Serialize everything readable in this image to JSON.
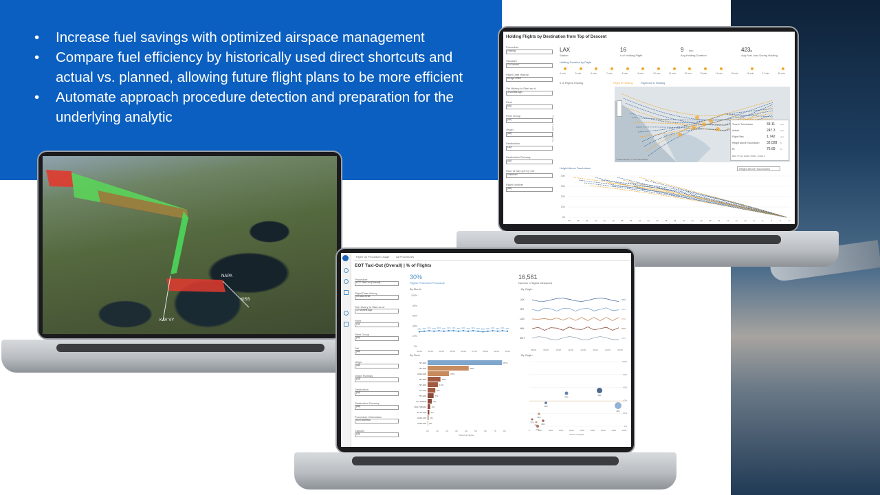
{
  "slide": {
    "bullets": [
      "Increase fuel savings with optimized airspace management",
      "Compare fuel efficiency by historically used direct shortcuts and actual vs. planned, allowing future flight plans to be more efficient",
      "Automate approach procedure detection and preparation for the underlying analytic"
    ],
    "colors": {
      "banner": "#0b5fc0",
      "text": "#ffffff"
    }
  },
  "holding_dashboard": {
    "title": "Holding Flights by Destination from Top of Descent",
    "filters": [
      "Procedure",
      "Visualize",
      "Flight Date History",
      "Set History to Start as of",
      "Fleet",
      "Fleet Group",
      "Origin",
      "Destination",
      "Destination Runway",
      "Hour of Day (UTC) | Dir",
      "Flight Number"
    ],
    "filter_values": [
      "Holding",
      "Go Around",
      "Entire Descent Phase",
      "21-Dec-2016",
      "01-Apr-2018",
      "3 Months Ago",
      "(All)",
      "(All)",
      "(All)",
      "LAX",
      "(All)",
      "Unknown",
      "(All)"
    ],
    "kpis": [
      {
        "value": "LAX",
        "label": "Station"
      },
      {
        "value": "16",
        "label": "# of Holding Flight"
      },
      {
        "value": "9",
        "unit": "min",
        "label": "Avg Holding Duration"
      },
      {
        "value": "423",
        "unit": "kg",
        "label": "Avg Fuel Loss During Holding"
      }
    ],
    "holding_duration_title": "Holding Duration by Flight",
    "duration_ticks": [
      "4 min",
      "5 min",
      "6 min",
      "7 min",
      "8 min",
      "9 min",
      "10 min",
      "11 min",
      "12 min",
      "13 min",
      "14 min",
      "15 min",
      "16 min",
      "17 min",
      "18 min"
    ],
    "flights_holding_label": "# of Flights Holding",
    "map_toggle": [
      "Flight in Holding",
      "Flight not in Holding"
    ],
    "tooltip": {
      "rows": [
        {
          "label": "Time to Touchdown",
          "value": "33.11",
          "unit": "min"
        },
        {
          "label": "Actual",
          "value": "247.3",
          "unit": "nmi"
        },
        {
          "label": "Flight Plan",
          "value": "1,742",
          "unit": "nmi"
        },
        {
          "label": "Height Above Touchdown",
          "value": "32,028",
          "unit": "ft"
        },
        {
          "label": "Rt",
          "value": "76.69",
          "unit": "%"
        }
      ],
      "footer": "DEN | TCH: 10420 / 0000 - 11442.9"
    },
    "map_attribution": "© 2022 Mapbox © OpenStreetMap",
    "height_chart_title": "Height Above Touchdown",
    "height_select": "Height Above Touchdown",
    "height_yticks": [
      "40K",
      "30K",
      "20K",
      "10K",
      "0K"
    ],
    "height_xticks": [
      "50",
      "48",
      "46",
      "44",
      "42",
      "40",
      "38",
      "36",
      "34",
      "32",
      "30",
      "28",
      "26",
      "24",
      "22",
      "20",
      "18",
      "16",
      "14",
      "12",
      "10",
      "8",
      "6",
      "4",
      "2",
      "0"
    ],
    "height_xlabel": "Time to Touchdown (min)",
    "y_axis_label": "Number of Flights (UTC day)",
    "colors": {
      "holding": "#f0a830",
      "not_holding": "#4a6e9a"
    }
  },
  "procedure_dashboard": {
    "tabs": [
      "Flight Op Procedure Usage",
      "All Procedures"
    ],
    "title": "EOT Taxi-Out (Overall) | % of Flights",
    "headline_pct": "30%",
    "headline_pct_label": "Flights Performed Procedure",
    "headline_count": "16,561",
    "headline_count_label": "Number of flights Measured",
    "filters": [
      "Procedure",
      "Flight Date History",
      "Set History to Start as of",
      "Fleet",
      "Fleet Group",
      "Tail",
      "Origin",
      "Origin Runway",
      "Destination",
      "Destination Runway",
      "Procedure Orientation",
      "Captain"
    ],
    "filter_values": [
      "EOT Taxi-Out (Overall)",
      "01-Mar-2018",
      "31-Apr-2018",
      "12 Months Ago",
      "(All)",
      "(All)",
      "(All)",
      "(All)",
      "(All)",
      "(All)",
      "(All)",
      "Not Essential",
      "(All)"
    ],
    "by_month": {
      "title": "By Month",
      "yticks": [
        "100%",
        "80%",
        "60%",
        "40%",
        "20%",
        "0%"
      ],
      "xticks": [
        "02/18",
        "03/18",
        "04/18",
        "05/18",
        "06/18",
        "07/18",
        "08/18",
        "09/18",
        "10/18"
      ],
      "values": [
        29,
        30,
        31,
        30,
        31,
        30,
        31,
        31,
        30,
        31,
        30,
        31,
        30,
        29,
        30,
        31,
        30,
        31,
        30
      ],
      "point_labels": [
        "29%",
        "30%",
        "31%",
        "30%",
        "31%",
        "30%",
        "31%",
        "31%",
        "30%",
        "31%",
        "30%",
        "31%",
        "30%",
        "29%",
        "30%",
        "31%",
        "30%",
        "31%",
        "30%"
      ]
    },
    "by_origin_line": {
      "title": "By Origin",
      "rows": [
        "LAX",
        "JFK",
        "LAS",
        "HNL",
        "MKT"
      ],
      "xticks": [
        "08/18",
        "09/18",
        "10/18",
        "11/18",
        "12/18",
        "01/19",
        "02/19",
        "03/19"
      ],
      "end_labels": [
        "46%",
        "43%",
        "37%",
        "32%",
        "28%"
      ]
    },
    "by_fleet": {
      "title": "By Fleet",
      "categories": [
        "737-900",
        "757-300",
        "A320-200",
        "767-300",
        "737-900",
        "777-200",
        "757-200",
        "777-200ER",
        "CRJ-700/200",
        "E170-200",
        "A319-100",
        "A320-200"
      ],
      "values": [
        87,
        48,
        25,
        15,
        12,
        9,
        7,
        5,
        3,
        2,
        1,
        0
      ],
      "labels": [
        "87%",
        "48%",
        "25%",
        "15%",
        "12%",
        "9%",
        "7%",
        "5%",
        "3%",
        "2%",
        "1%",
        "0%"
      ],
      "xticks": [
        "0K",
        "1K",
        "2K",
        "3K",
        "4K",
        "5K",
        "6K",
        "7K",
        "8K"
      ],
      "xlabel": "Total # of Flights"
    },
    "by_origin_bubble": {
      "title": "By Origin",
      "yticks": [
        "100%",
        "80%",
        "60%",
        "40%",
        "20%",
        "0%"
      ],
      "xticks": [
        "0",
        "500",
        "1000",
        "1500",
        "2000",
        "2500",
        "3000",
        "3500",
        "4000",
        "4500"
      ],
      "xlabel": "Total # of Flights",
      "labels": [
        "30%",
        "25%",
        "48%",
        "32%",
        "34%",
        "27%",
        "35%",
        "28%",
        "21%"
      ]
    },
    "colors": {
      "accent": "#4a90c8",
      "bar_top": "#7fa6cc",
      "bar_mid": "#c88b5e",
      "bar_low": "#8e4a3a"
    }
  },
  "map_laptop": {
    "labels": [
      "NAPA",
      "KAV VY",
      "KISS"
    ],
    "colors": {
      "route_high": "#e03a2e",
      "route_low": "#4ad85a"
    }
  }
}
